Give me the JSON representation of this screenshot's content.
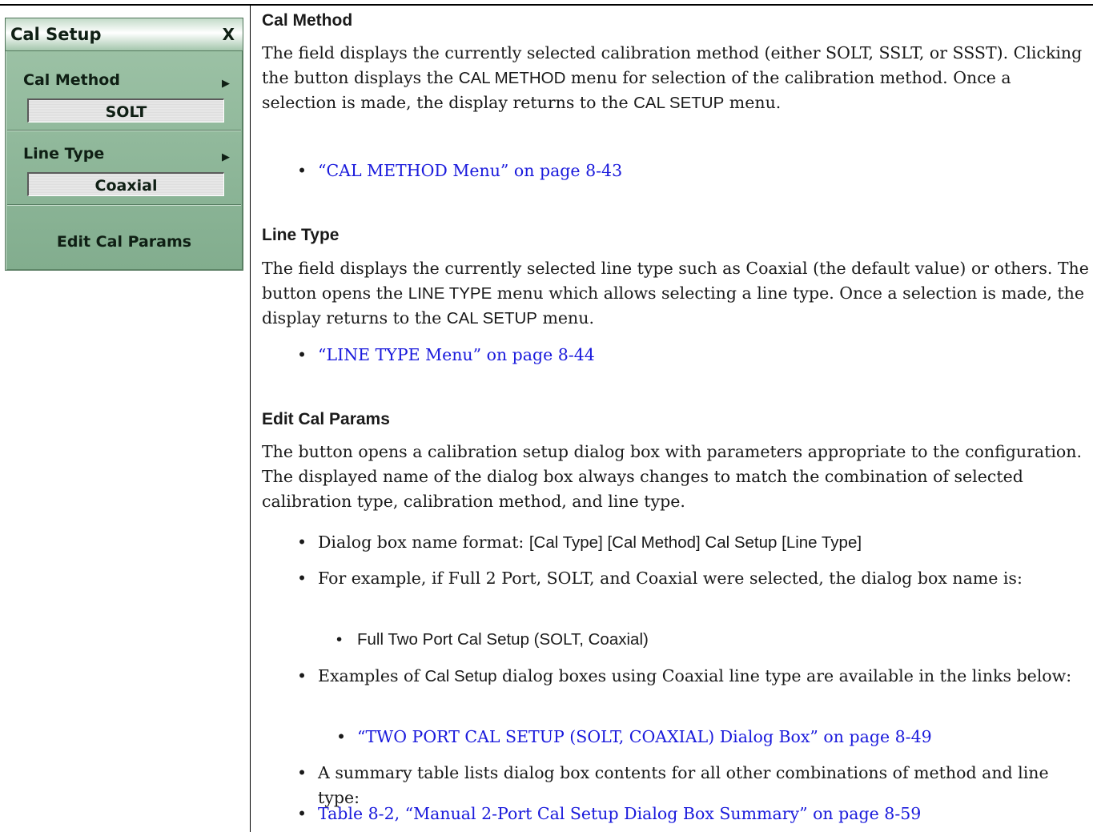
{
  "menu": {
    "title": "Cal Setup",
    "close_label": "X",
    "cal_method": {
      "label": "Cal Method",
      "arrow": "▶",
      "value": "SOLT"
    },
    "line_type": {
      "label": "Line Type",
      "arrow": "▶",
      "value": "Coaxial"
    },
    "edit_button": "Edit Cal Params"
  },
  "sections": {
    "cal_method": {
      "heading": "Cal Method",
      "p_serif_1": "The field displays the currently selected calibration method (either SOLT, SSLT, or SSST). Clicking the button displays the ",
      "p_sans_1": "CAL METHOD",
      "p_serif_2": " menu for selection of the calibration method. Once a selection is made, the display returns to the ",
      "p_sans_2": "CAL SETUP",
      "p_serif_3": " menu.",
      "link": "“CAL METHOD Menu” on page 8-43"
    },
    "line_type": {
      "heading": "Line Type",
      "p_serif_1": "The field displays the currently selected line type such as Coaxial (the default value) or others. The button opens the ",
      "p_sans_1": "LINE TYPE",
      "p_serif_2": " menu which allows selecting a line type. Once a selection is made, the display returns to the ",
      "p_sans_2": "CAL SETUP",
      "p_serif_3": " menu.",
      "link": "“LINE TYPE Menu” on page 8-44"
    },
    "edit_cal_params": {
      "heading": "Edit Cal Params",
      "paragraph": "The button opens a calibration setup dialog box with parameters appropriate to the configuration. The displayed name of the dialog box always changes to match the combination of selected calibration type, calibration method, and line type.",
      "bullet_1_serif": "Dialog box name format: ",
      "bullet_1_sans": "[Cal Type] [Cal Method] Cal Setup [Line Type]",
      "bullet_2": "For example, if Full 2 Port, SOLT, and Coaxial were selected, the dialog box name is:",
      "sub_bullet_1": "Full Two Port Cal Setup (SOLT, Coaxial)",
      "bullet_3_serif_1": "Examples of ",
      "bullet_3_sans": "Cal Setup",
      "bullet_3_serif_2": " dialog boxes using Coaxial line type are available in the links below:",
      "sub_bullet_2_link": "“TWO PORT CAL SETUP (SOLT, COAXIAL) Dialog Box” on page 8-49",
      "bullet_4": "A summary table lists dialog box contents for all other combinations of method and line type:",
      "bullet_5_link": "Table 8-2, “Manual 2-Port Cal Setup Dialog Box Summary” on page 8-59"
    }
  }
}
